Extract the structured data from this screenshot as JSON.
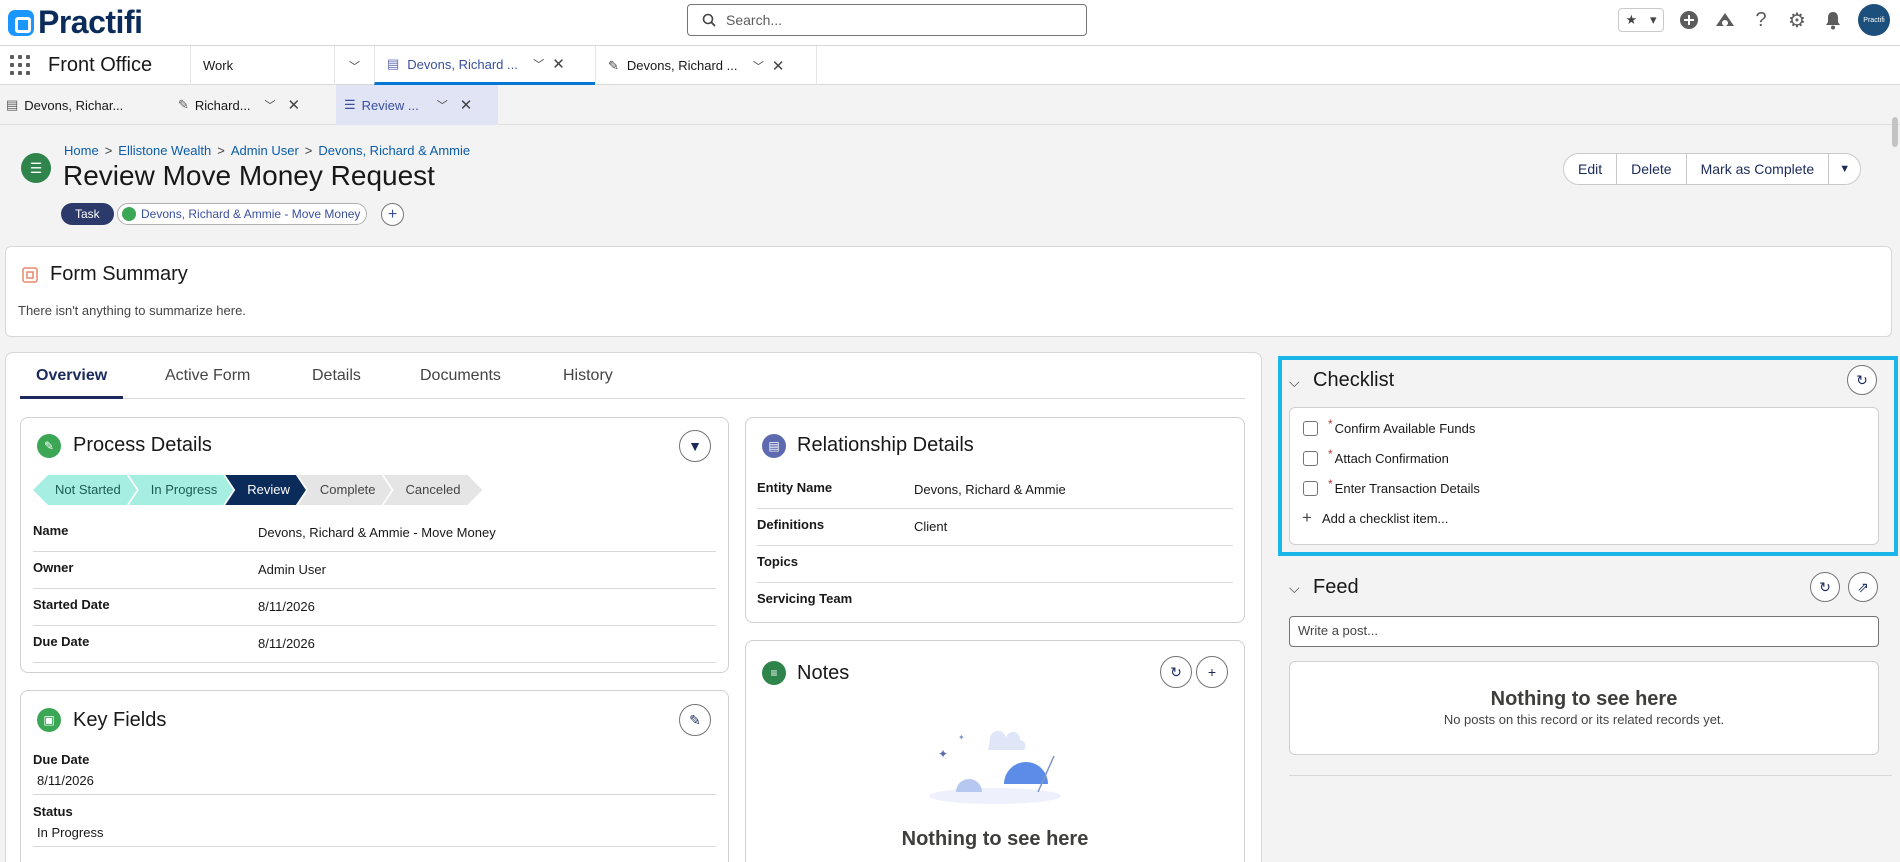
{
  "header": {
    "logo_text": "Practifi",
    "search_placeholder": "Search...",
    "avatar_text": "Practifi"
  },
  "nav": {
    "app_name": "Front Office",
    "tabs": [
      {
        "label": "Work"
      },
      {
        "label": "Devons, Richard ..."
      },
      {
        "label": "Devons, Richard ..."
      }
    ]
  },
  "subtabs": [
    {
      "label": "Devons, Richar..."
    },
    {
      "label": "Richard..."
    },
    {
      "label": "Review ..."
    }
  ],
  "record": {
    "breadcrumb": [
      "Home",
      "Ellistone Wealth",
      "Admin User",
      "Devons, Richard & Ammie"
    ],
    "title": "Review Move Money Request",
    "type_pill": "Task",
    "related_pill": "Devons, Richard & Ammie - Move Money",
    "actions": {
      "edit": "Edit",
      "delete": "Delete",
      "complete": "Mark as Complete"
    }
  },
  "form_summary": {
    "title": "Form Summary",
    "empty_text": "There isn't anything to summarize here."
  },
  "tabs": [
    "Overview",
    "Active Form",
    "Details",
    "Documents",
    "History"
  ],
  "process_details": {
    "title": "Process Details",
    "stages": [
      "Not Started",
      "In Progress",
      "Review",
      "Complete",
      "Canceled"
    ],
    "current_stage": "Review",
    "fields": [
      {
        "label": "Name",
        "value": "Devons, Richard & Ammie - Move Money"
      },
      {
        "label": "Owner",
        "value": "Admin User"
      },
      {
        "label": "Started Date",
        "value": "8/11/2026"
      },
      {
        "label": "Due Date",
        "value": "8/11/2026"
      }
    ]
  },
  "key_fields": {
    "title": "Key Fields",
    "fields": [
      {
        "label": "Due Date",
        "value": "8/11/2026"
      },
      {
        "label": "Status",
        "value": "In Progress"
      }
    ]
  },
  "relationship_details": {
    "title": "Relationship Details",
    "fields": [
      {
        "label": "Entity Name",
        "value": "Devons, Richard & Ammie"
      },
      {
        "label": "Definitions",
        "value": "Client"
      },
      {
        "label": "Topics",
        "value": ""
      },
      {
        "label": "Servicing Team",
        "value": ""
      }
    ]
  },
  "notes": {
    "title": "Notes",
    "empty_title": "Nothing to see here"
  },
  "checklist": {
    "title": "Checklist",
    "items": [
      "Confirm Available Funds",
      "Attach Confirmation",
      "Enter Transaction Details"
    ],
    "add_label": "Add a checklist item..."
  },
  "feed": {
    "title": "Feed",
    "post_placeholder": "Write a post...",
    "empty_title": "Nothing to see here",
    "empty_text": "No posts on this record or its related records yet."
  },
  "colors": {
    "accent": "#0176d3",
    "navy": "#0b2c5a",
    "highlight": "#1ab7ea",
    "stage_done": "#a7eee2",
    "green_icon": "#2e844a"
  }
}
